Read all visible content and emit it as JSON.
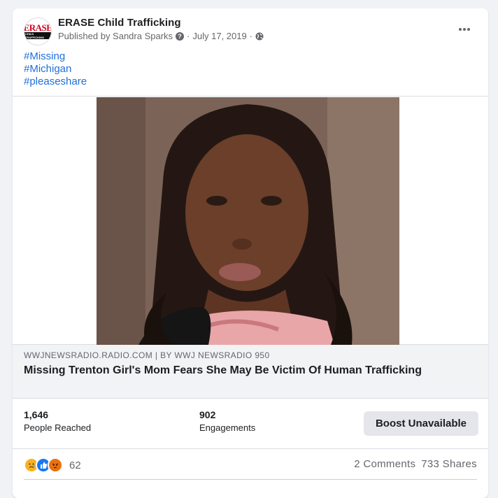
{
  "post": {
    "page_name": "ERASE Child Trafficking",
    "avatar": {
      "logo_top": "ERASE",
      "logo_bottom": "CHILD TRAFFICKING"
    },
    "published_by": "Published by Sandra Sparks",
    "separator": "·",
    "date": "July 17, 2019",
    "hashtags": [
      "#Missing",
      "#Michigan",
      "#pleaseshare"
    ]
  },
  "link_preview": {
    "domain": "WWJNEWSRADIO.RADIO.COM | BY WWJ NEWSRADIO 950",
    "title": "Missing Trenton Girl's Mom Fears She May Be Victim Of Human Trafficking"
  },
  "insights": {
    "people_reached_value": "1,646",
    "people_reached_label": "People Reached",
    "engagements_value": "902",
    "engagements_label": "Engagements",
    "boost_label": "Boost Unavailable"
  },
  "footer": {
    "reaction_count": "62",
    "comments": "2 Comments",
    "shares": "733 Shares"
  },
  "icons": [
    "help-icon",
    "globe-icon",
    "more-options-icon",
    "sad-reaction-icon",
    "like-reaction-icon",
    "angry-reaction-icon"
  ],
  "colors": {
    "link": "#216fdb",
    "like": "#1877f2",
    "brand_red": "#d0021b"
  }
}
